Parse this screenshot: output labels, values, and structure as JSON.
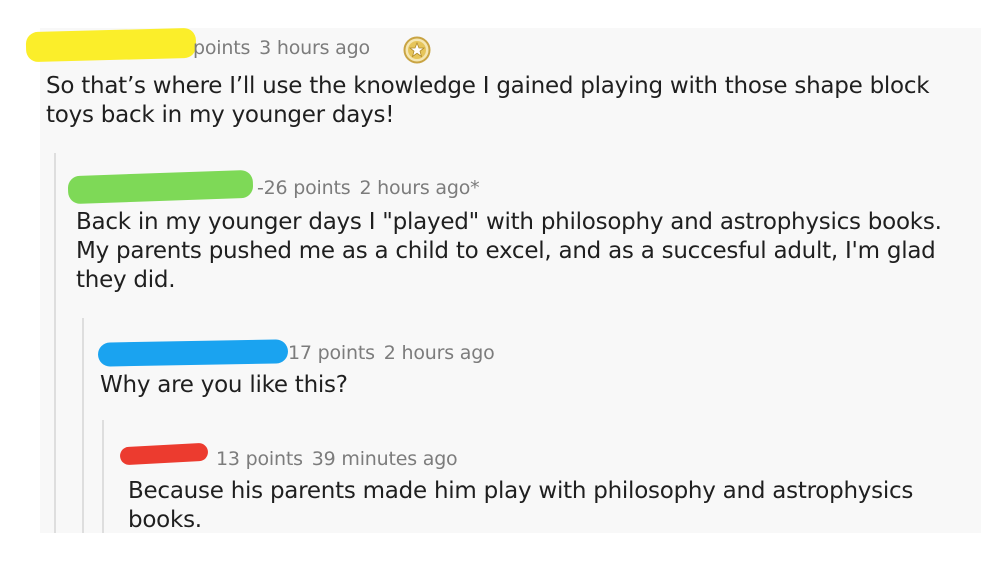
{
  "comments": [
    {
      "points": "points",
      "time": "3 hours ago",
      "body": "So that’s where I’ll use the knowledge I gained playing with those shape block toys back in my younger days!",
      "redaction_color": "#fbee2a"
    },
    {
      "points": "-26 points",
      "time": "2 hours ago*",
      "body": "Back in my younger days I \"played\" with philosophy and astrophysics books. My parents pushed me as a child to excel, and as a succesful adult, I'm glad they did.",
      "redaction_color": "#7ed957"
    },
    {
      "points": "17 points",
      "time": "2 hours ago",
      "body": "Why are you like this?",
      "redaction_color": "#1aa3f0"
    },
    {
      "points": "13 points",
      "time": "39 minutes ago",
      "body": "Because his parents made him play with philosophy and astrophysics books.",
      "redaction_color": "#ec3b2f"
    }
  ],
  "icons": {
    "gilded": "gold-star-icon"
  },
  "colors": {
    "gold": "#d9b54a",
    "meta_text": "#7c7c7c",
    "body_text": "#1f1f1f",
    "thread_line": "#dedede"
  }
}
